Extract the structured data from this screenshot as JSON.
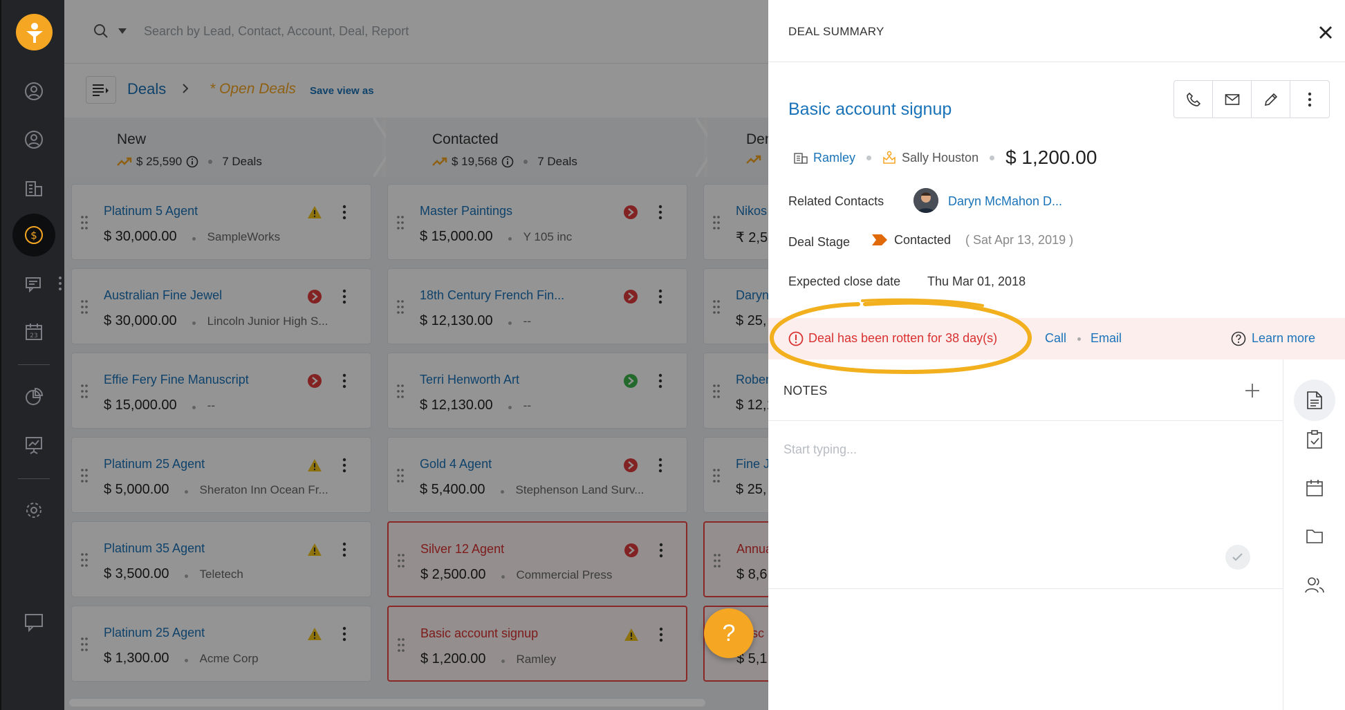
{
  "search": {
    "placeholder": "Search by Lead, Contact, Account, Deal, Report"
  },
  "breadcrumb": {
    "root": "Deals",
    "view": "* Open Deals",
    "save_view": "Save view as"
  },
  "stages": [
    {
      "name": "New",
      "amount": "$ 25,590",
      "count": "7 Deals"
    },
    {
      "name": "Contacted",
      "amount": "$ 19,568",
      "count": "7 Deals"
    },
    {
      "name": "Dem",
      "amount": "",
      "count": ""
    }
  ],
  "columns": [
    [
      {
        "title": "Platinum 5 Agent",
        "amount": "$ 30,000.00",
        "org": "SampleWorks",
        "status": "warning"
      },
      {
        "title": "Australian Fine Jewel",
        "amount": "$ 30,000.00",
        "org": "Lincoln Junior High S...",
        "status": "red"
      },
      {
        "title": "Effie Fery Fine Manuscript",
        "amount": "$ 15,000.00",
        "org": "--",
        "status": "red"
      },
      {
        "title": "Platinum 25 Agent",
        "amount": "$ 5,000.00",
        "org": "Sheraton Inn Ocean Fr...",
        "status": "warning"
      },
      {
        "title": "Platinum 35 Agent",
        "amount": "$ 3,500.00",
        "org": "Teletech",
        "status": "warning"
      },
      {
        "title": "Platinum 25 Agent",
        "amount": "$ 1,300.00",
        "org": "Acme Corp",
        "status": "warning"
      }
    ],
    [
      {
        "title": "Master Paintings",
        "amount": "$ 15,000.00",
        "org": "Y 105 inc",
        "status": "red"
      },
      {
        "title": "18th Century French Fin...",
        "amount": "$ 12,130.00",
        "org": "--",
        "status": "red"
      },
      {
        "title": "Terri Henworth Art",
        "amount": "$ 12,130.00",
        "org": "--",
        "status": "green"
      },
      {
        "title": "Gold 4 Agent",
        "amount": "$ 5,400.00",
        "org": "Stephenson Land Surv...",
        "status": "red"
      },
      {
        "title": "Silver 12 Agent",
        "amount": "$ 2,500.00",
        "org": "Commercial Press",
        "status": "red",
        "rotten": true
      },
      {
        "title": "Basic account signup",
        "amount": "$ 1,200.00",
        "org": "Ramley",
        "status": "warning",
        "rotten": true
      }
    ],
    [
      {
        "title": "Nikos",
        "amount": "₹ 2,5",
        "org": "",
        "status": ""
      },
      {
        "title": "Daryn",
        "amount": "$ 25,",
        "org": "",
        "status": ""
      },
      {
        "title": "Rober",
        "amount": "$ 12,1",
        "org": "",
        "status": ""
      },
      {
        "title": "Fine J",
        "amount": "$ 25,",
        "org": "",
        "status": ""
      },
      {
        "title": "Annua",
        "amount": "$ 8,6",
        "org": "",
        "status": "",
        "rotten": true
      },
      {
        "title": "Basc",
        "amount": "$ 5,1",
        "org": "",
        "status": "",
        "rotten": true
      }
    ]
  ],
  "panel": {
    "title": "DEAL SUMMARY",
    "deal_name": "Basic account signup",
    "account": "Ramley",
    "owner": "Sally Houston",
    "value": "$ 1,200.00",
    "related_contacts_label": "Related Contacts",
    "related_contact": "Daryn McMahon D...",
    "deal_stage_label": "Deal Stage",
    "deal_stage": "Contacted",
    "deal_stage_date": "( Sat Apr 13, 2019 )",
    "close_date_label": "Expected close date",
    "close_date": "Thu Mar 01, 2018",
    "rotten_message": "Deal has been rotten for 38 day(s)",
    "call": "Call",
    "email": "Email",
    "learn_more": "Learn more",
    "notes_title": "NOTES",
    "notes_placeholder": "Start typing..."
  },
  "help_fab": "?",
  "colors": {
    "accent": "#f5a623",
    "link": "#1a73b8",
    "danger": "#d93030",
    "rail": "#222428"
  }
}
